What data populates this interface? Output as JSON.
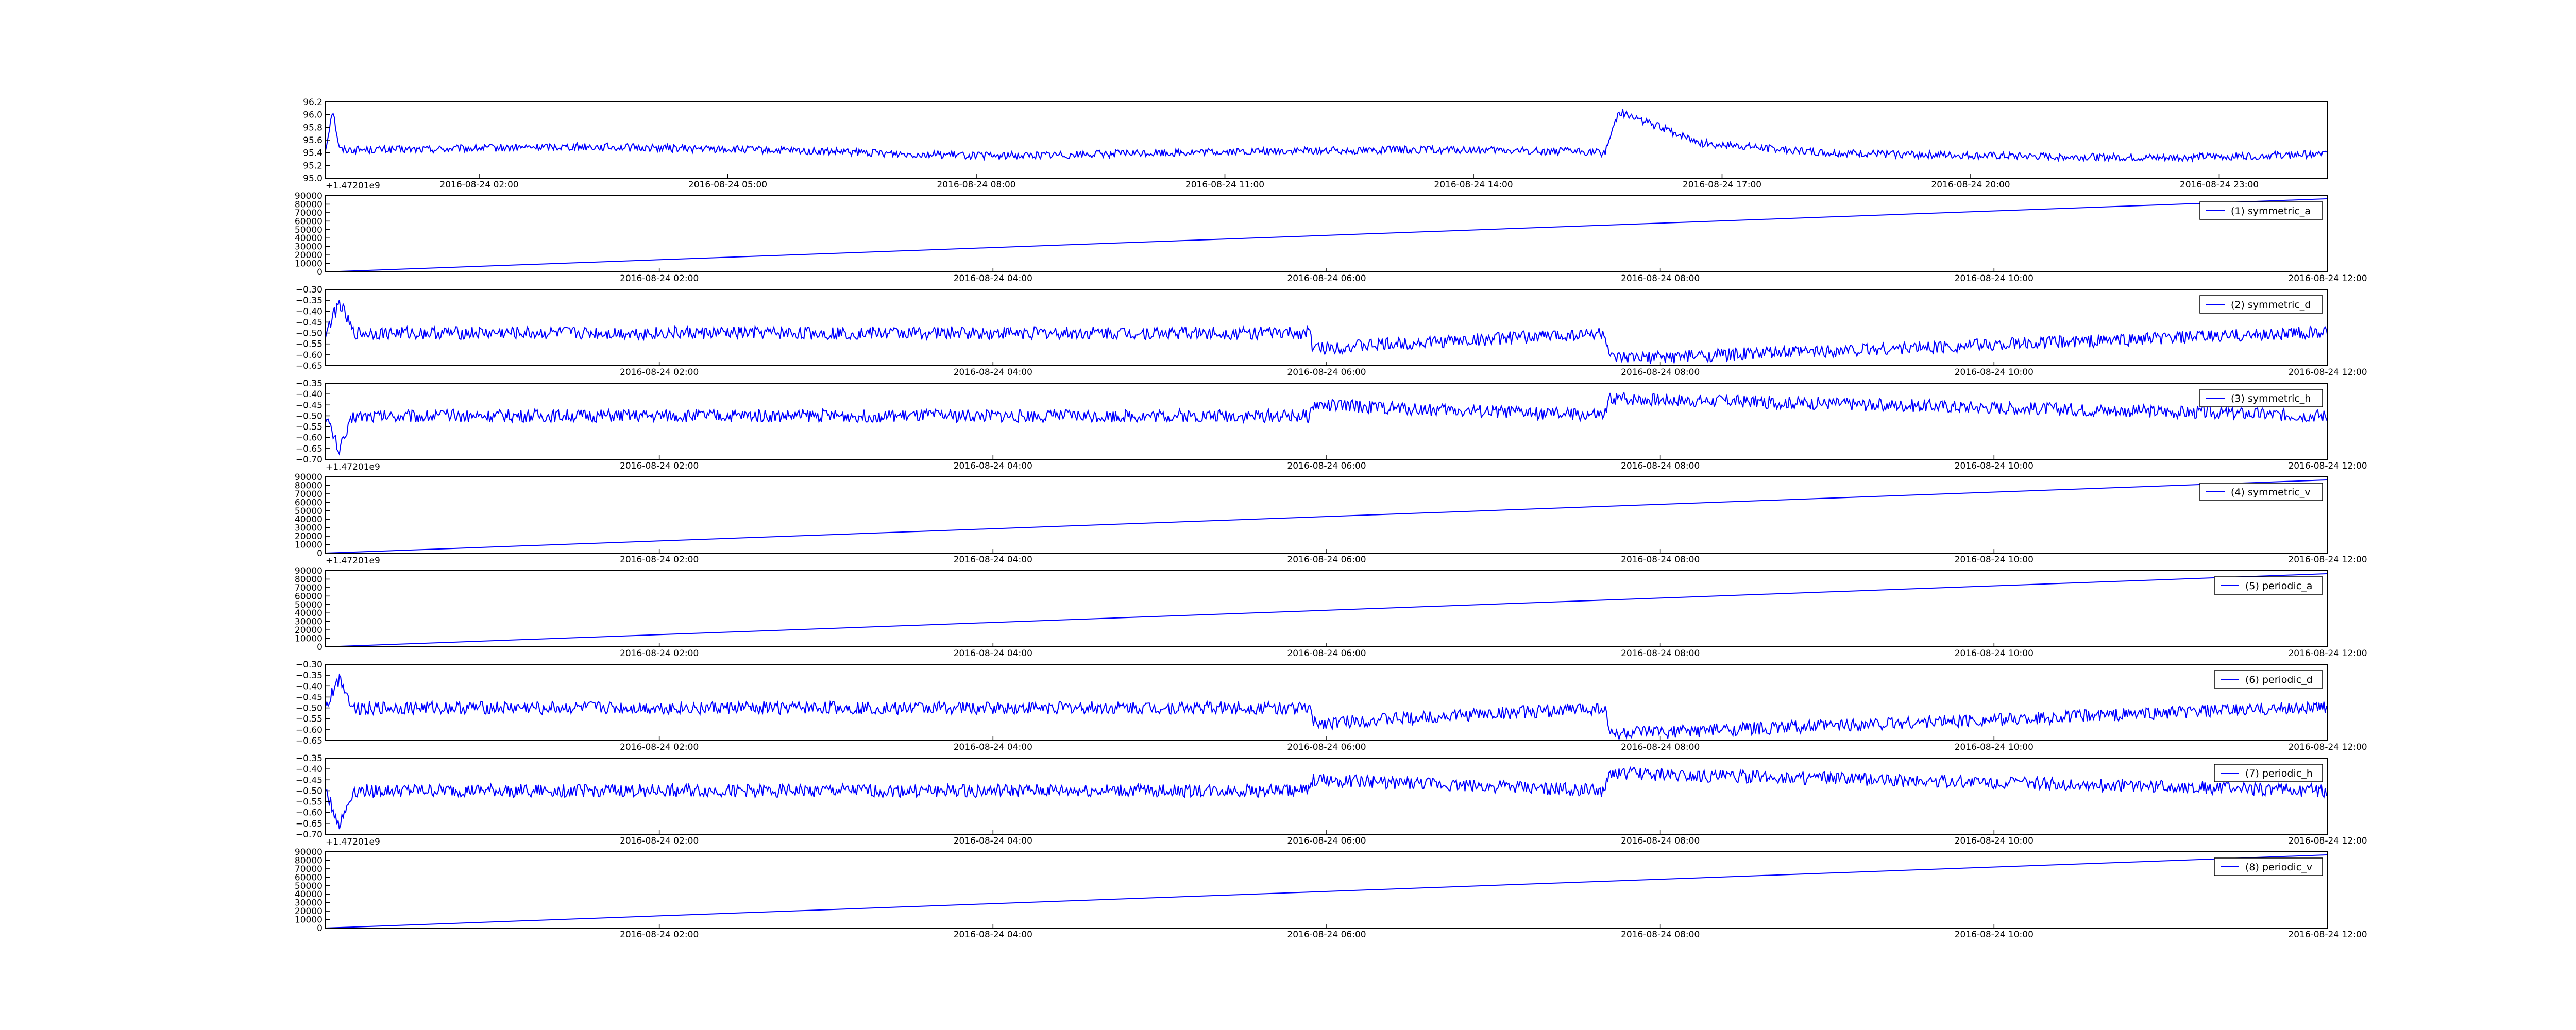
{
  "colors": {
    "line": "#0000ff",
    "axes": "#000000",
    "background": "#ffffff"
  },
  "chart_data": [
    {
      "type": "line",
      "x_ticks": [
        "2016-08-24 02:00",
        "2016-08-24 05:00",
        "2016-08-24 08:00",
        "2016-08-24 11:00",
        "2016-08-24 14:00",
        "2016-08-24 17:00",
        "2016-08-24 20:00",
        "2016-08-24 23:00"
      ],
      "y_ticks": [
        "95.0",
        "95.2",
        "95.4",
        "95.6",
        "95.8",
        "96.0",
        "96.2"
      ],
      "ylim": [
        95.0,
        96.2
      ],
      "offset_text": "+1.47201e9",
      "legend": "",
      "x": [
        "2016-08-24 00:00",
        "2016-08-24 00:05",
        "2016-08-24 00:10",
        "2016-08-24 01:00",
        "2016-08-24 03:00",
        "2016-08-24 05:00",
        "2016-08-24 08:00",
        "2016-08-24 10:00",
        "2016-08-24 13:00",
        "2016-08-24 15:00",
        "2016-08-24 15:20",
        "2016-08-24 15:30",
        "2016-08-24 16:30",
        "2016-08-24 18:00",
        "2016-08-24 20:00",
        "2016-08-24 22:00",
        "2016-08-24 24:00"
      ],
      "values": [
        95.45,
        96.1,
        95.45,
        95.45,
        95.5,
        95.45,
        95.35,
        95.4,
        95.45,
        95.42,
        95.4,
        96.05,
        95.55,
        95.4,
        95.35,
        95.32,
        95.38
      ],
      "noise": 0.06
    },
    {
      "type": "line",
      "x_ticks": [
        "2016-08-24 02:00",
        "2016-08-24 04:00",
        "2016-08-24 06:00",
        "2016-08-24 08:00",
        "2016-08-24 10:00",
        "2016-08-24 12:00"
      ],
      "y_ticks": [
        "0",
        "10000",
        "20000",
        "30000",
        "40000",
        "50000",
        "60000",
        "70000",
        "80000",
        "90000"
      ],
      "ylim": [
        0,
        90000
      ],
      "offset_text": "",
      "legend": "(1) symmetric_a",
      "x": [
        "2016-08-24 00:00",
        "2016-08-24 12:00"
      ],
      "values": [
        0,
        86400
      ],
      "noise": 0
    },
    {
      "type": "line",
      "x_ticks": [
        "2016-08-24 02:00",
        "2016-08-24 04:00",
        "2016-08-24 06:00",
        "2016-08-24 08:00",
        "2016-08-24 10:00",
        "2016-08-24 12:00"
      ],
      "y_ticks": [
        "−0.65",
        "−0.60",
        "−0.55",
        "−0.50",
        "−0.45",
        "−0.40",
        "−0.35",
        "−0.30"
      ],
      "ylim": [
        -0.65,
        -0.3
      ],
      "offset_text": "",
      "legend": "(2) symmetric_d",
      "x": [
        "2016-08-24 00:00",
        "2016-08-24 00:05",
        "2016-08-24 00:10",
        "2016-08-24 05:54",
        "2016-08-24 05:55",
        "2016-08-24 07:40",
        "2016-08-24 07:42",
        "2016-08-24 11:50",
        "2016-08-24 12:00"
      ],
      "values": [
        -0.5,
        -0.36,
        -0.5,
        -0.5,
        -0.57,
        -0.5,
        -0.62,
        -0.5,
        -0.5
      ],
      "noise": 0.03
    },
    {
      "type": "line",
      "x_ticks": [
        "2016-08-24 02:00",
        "2016-08-24 04:00",
        "2016-08-24 06:00",
        "2016-08-24 08:00",
        "2016-08-24 10:00",
        "2016-08-24 12:00"
      ],
      "y_ticks": [
        "−0.70",
        "−0.65",
        "−0.60",
        "−0.55",
        "−0.50",
        "−0.45",
        "−0.40",
        "−0.35"
      ],
      "ylim": [
        -0.7,
        -0.35
      ],
      "offset_text": "+1.47201e9",
      "legend": "(3) symmetric_h",
      "x": [
        "2016-08-24 00:00",
        "2016-08-24 00:05",
        "2016-08-24 00:10",
        "2016-08-24 05:54",
        "2016-08-24 05:55",
        "2016-08-24 07:40",
        "2016-08-24 07:42",
        "2016-08-24 12:00"
      ],
      "values": [
        -0.5,
        -0.66,
        -0.5,
        -0.5,
        -0.45,
        -0.5,
        -0.42,
        -0.5
      ],
      "noise": 0.03
    },
    {
      "type": "line",
      "x_ticks": [
        "2016-08-24 02:00",
        "2016-08-24 04:00",
        "2016-08-24 06:00",
        "2016-08-24 08:00",
        "2016-08-24 10:00",
        "2016-08-24 12:00"
      ],
      "y_ticks": [
        "0",
        "10000",
        "20000",
        "30000",
        "40000",
        "50000",
        "60000",
        "70000",
        "80000",
        "90000"
      ],
      "ylim": [
        0,
        90000
      ],
      "offset_text": "+1.47201e9",
      "legend": "(4) symmetric_v",
      "x": [
        "2016-08-24 00:00",
        "2016-08-24 12:00"
      ],
      "values": [
        0,
        86400
      ],
      "noise": 0
    },
    {
      "type": "line",
      "x_ticks": [
        "2016-08-24 02:00",
        "2016-08-24 04:00",
        "2016-08-24 06:00",
        "2016-08-24 08:00",
        "2016-08-24 10:00",
        "2016-08-24 12:00"
      ],
      "y_ticks": [
        "0",
        "10000",
        "20000",
        "30000",
        "40000",
        "50000",
        "60000",
        "70000",
        "80000",
        "90000"
      ],
      "ylim": [
        0,
        90000
      ],
      "offset_text": "",
      "legend": "(5) periodic_a",
      "x": [
        "2016-08-24 00:00",
        "2016-08-24 12:00"
      ],
      "values": [
        0,
        86400
      ],
      "noise": 0
    },
    {
      "type": "line",
      "x_ticks": [
        "2016-08-24 02:00",
        "2016-08-24 04:00",
        "2016-08-24 06:00",
        "2016-08-24 08:00",
        "2016-08-24 10:00",
        "2016-08-24 12:00"
      ],
      "y_ticks": [
        "−0.65",
        "−0.60",
        "−0.55",
        "−0.50",
        "−0.45",
        "−0.40",
        "−0.35",
        "−0.30"
      ],
      "ylim": [
        -0.65,
        -0.3
      ],
      "offset_text": "",
      "legend": "(6) periodic_d",
      "x": [
        "2016-08-24 00:00",
        "2016-08-24 00:05",
        "2016-08-24 00:10",
        "2016-08-24 05:54",
        "2016-08-24 05:55",
        "2016-08-24 07:40",
        "2016-08-24 07:42",
        "2016-08-24 11:50",
        "2016-08-24 12:00"
      ],
      "values": [
        -0.5,
        -0.36,
        -0.5,
        -0.5,
        -0.57,
        -0.5,
        -0.62,
        -0.5,
        -0.5
      ],
      "noise": 0.03
    },
    {
      "type": "line",
      "x_ticks": [
        "2016-08-24 02:00",
        "2016-08-24 04:00",
        "2016-08-24 06:00",
        "2016-08-24 08:00",
        "2016-08-24 10:00",
        "2016-08-24 12:00"
      ],
      "y_ticks": [
        "−0.70",
        "−0.65",
        "−0.60",
        "−0.55",
        "−0.50",
        "−0.45",
        "−0.40",
        "−0.35"
      ],
      "ylim": [
        -0.7,
        -0.35
      ],
      "offset_text": "+1.47201e9",
      "legend": "(7) periodic_h",
      "x": [
        "2016-08-24 00:00",
        "2016-08-24 00:05",
        "2016-08-24 00:10",
        "2016-08-24 05:54",
        "2016-08-24 05:55",
        "2016-08-24 07:40",
        "2016-08-24 07:42",
        "2016-08-24 12:00"
      ],
      "values": [
        -0.5,
        -0.66,
        -0.5,
        -0.5,
        -0.45,
        -0.5,
        -0.42,
        -0.5
      ],
      "noise": 0.03
    },
    {
      "type": "line",
      "x_ticks": [
        "2016-08-24 02:00",
        "2016-08-24 04:00",
        "2016-08-24 06:00",
        "2016-08-24 08:00",
        "2016-08-24 10:00",
        "2016-08-24 12:00"
      ],
      "y_ticks": [
        "0",
        "10000",
        "20000",
        "30000",
        "40000",
        "50000",
        "60000",
        "70000",
        "80000",
        "90000"
      ],
      "ylim": [
        0,
        90000
      ],
      "offset_text": "",
      "legend": "(8) periodic_v",
      "x": [
        "2016-08-24 00:00",
        "2016-08-24 12:00"
      ],
      "values": [
        0,
        86400
      ],
      "noise": 0
    }
  ]
}
